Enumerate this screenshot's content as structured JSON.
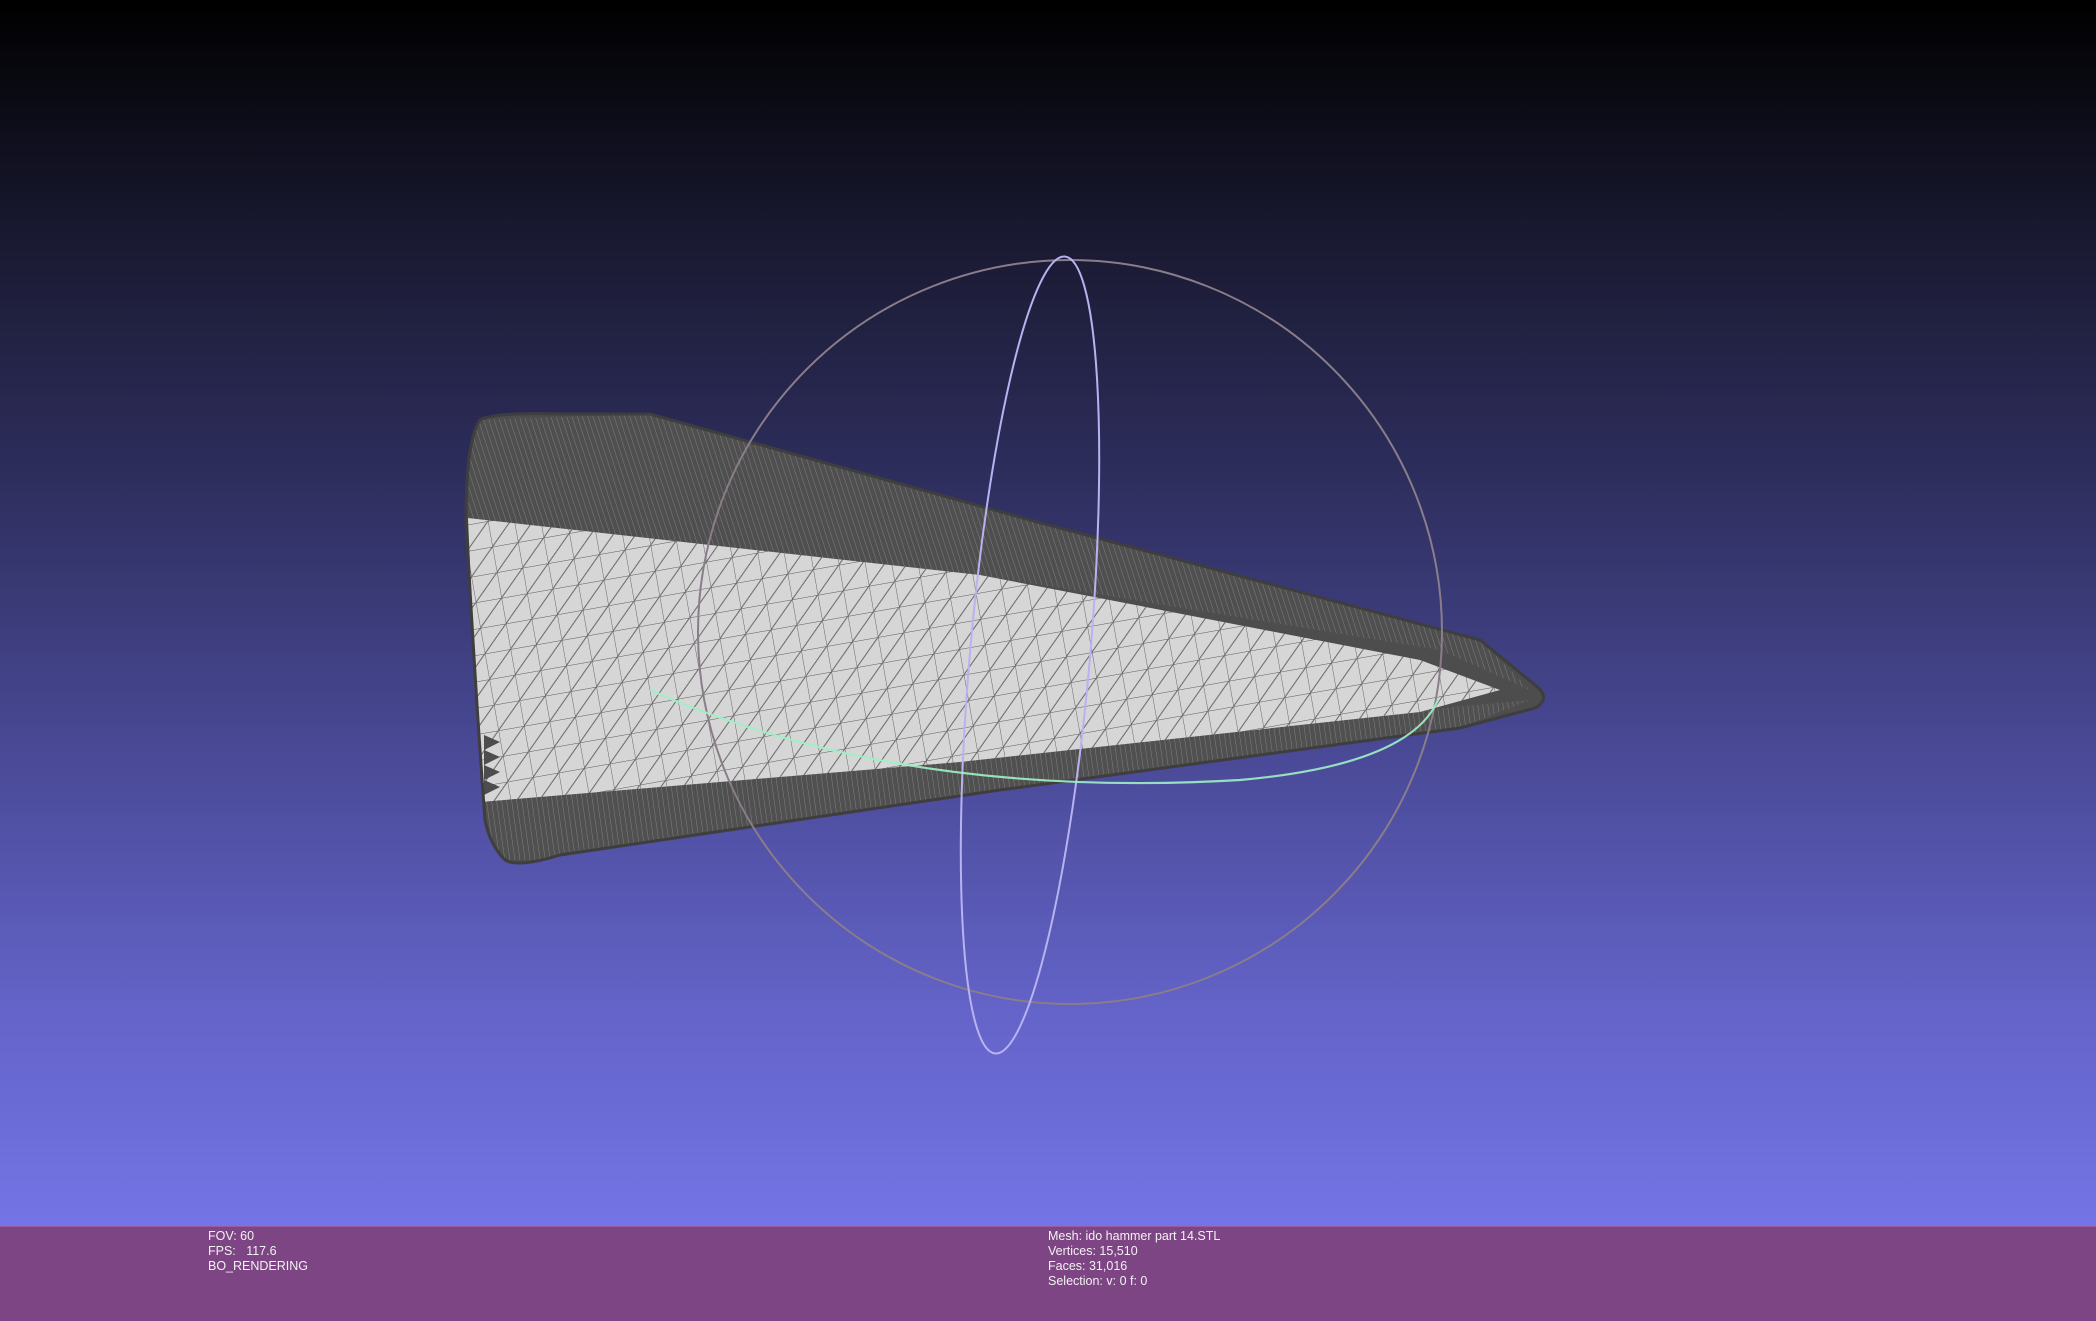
{
  "viewport": {
    "name": "3d-viewport"
  },
  "hud_left": {
    "fov": "FOV: 60",
    "fps": "FPS:   117.6",
    "mode": "BO_RENDERING"
  },
  "hud_right": {
    "mesh": "Mesh: ido hammer part 14.STL",
    "vertices": "Vertices: 15,510",
    "faces": "Faces: 31,016",
    "selection": "Selection: v: 0 f: 0"
  },
  "colors": {
    "statusbar": "#7e4584",
    "mesh_fill": "#d4d4d4",
    "mesh_edge": "#4d4d4d",
    "trackball_outer": "#8a7d8a",
    "trackball_vertical": "#b7b3f0",
    "trackball_horizontal": "#9ff0c4"
  }
}
